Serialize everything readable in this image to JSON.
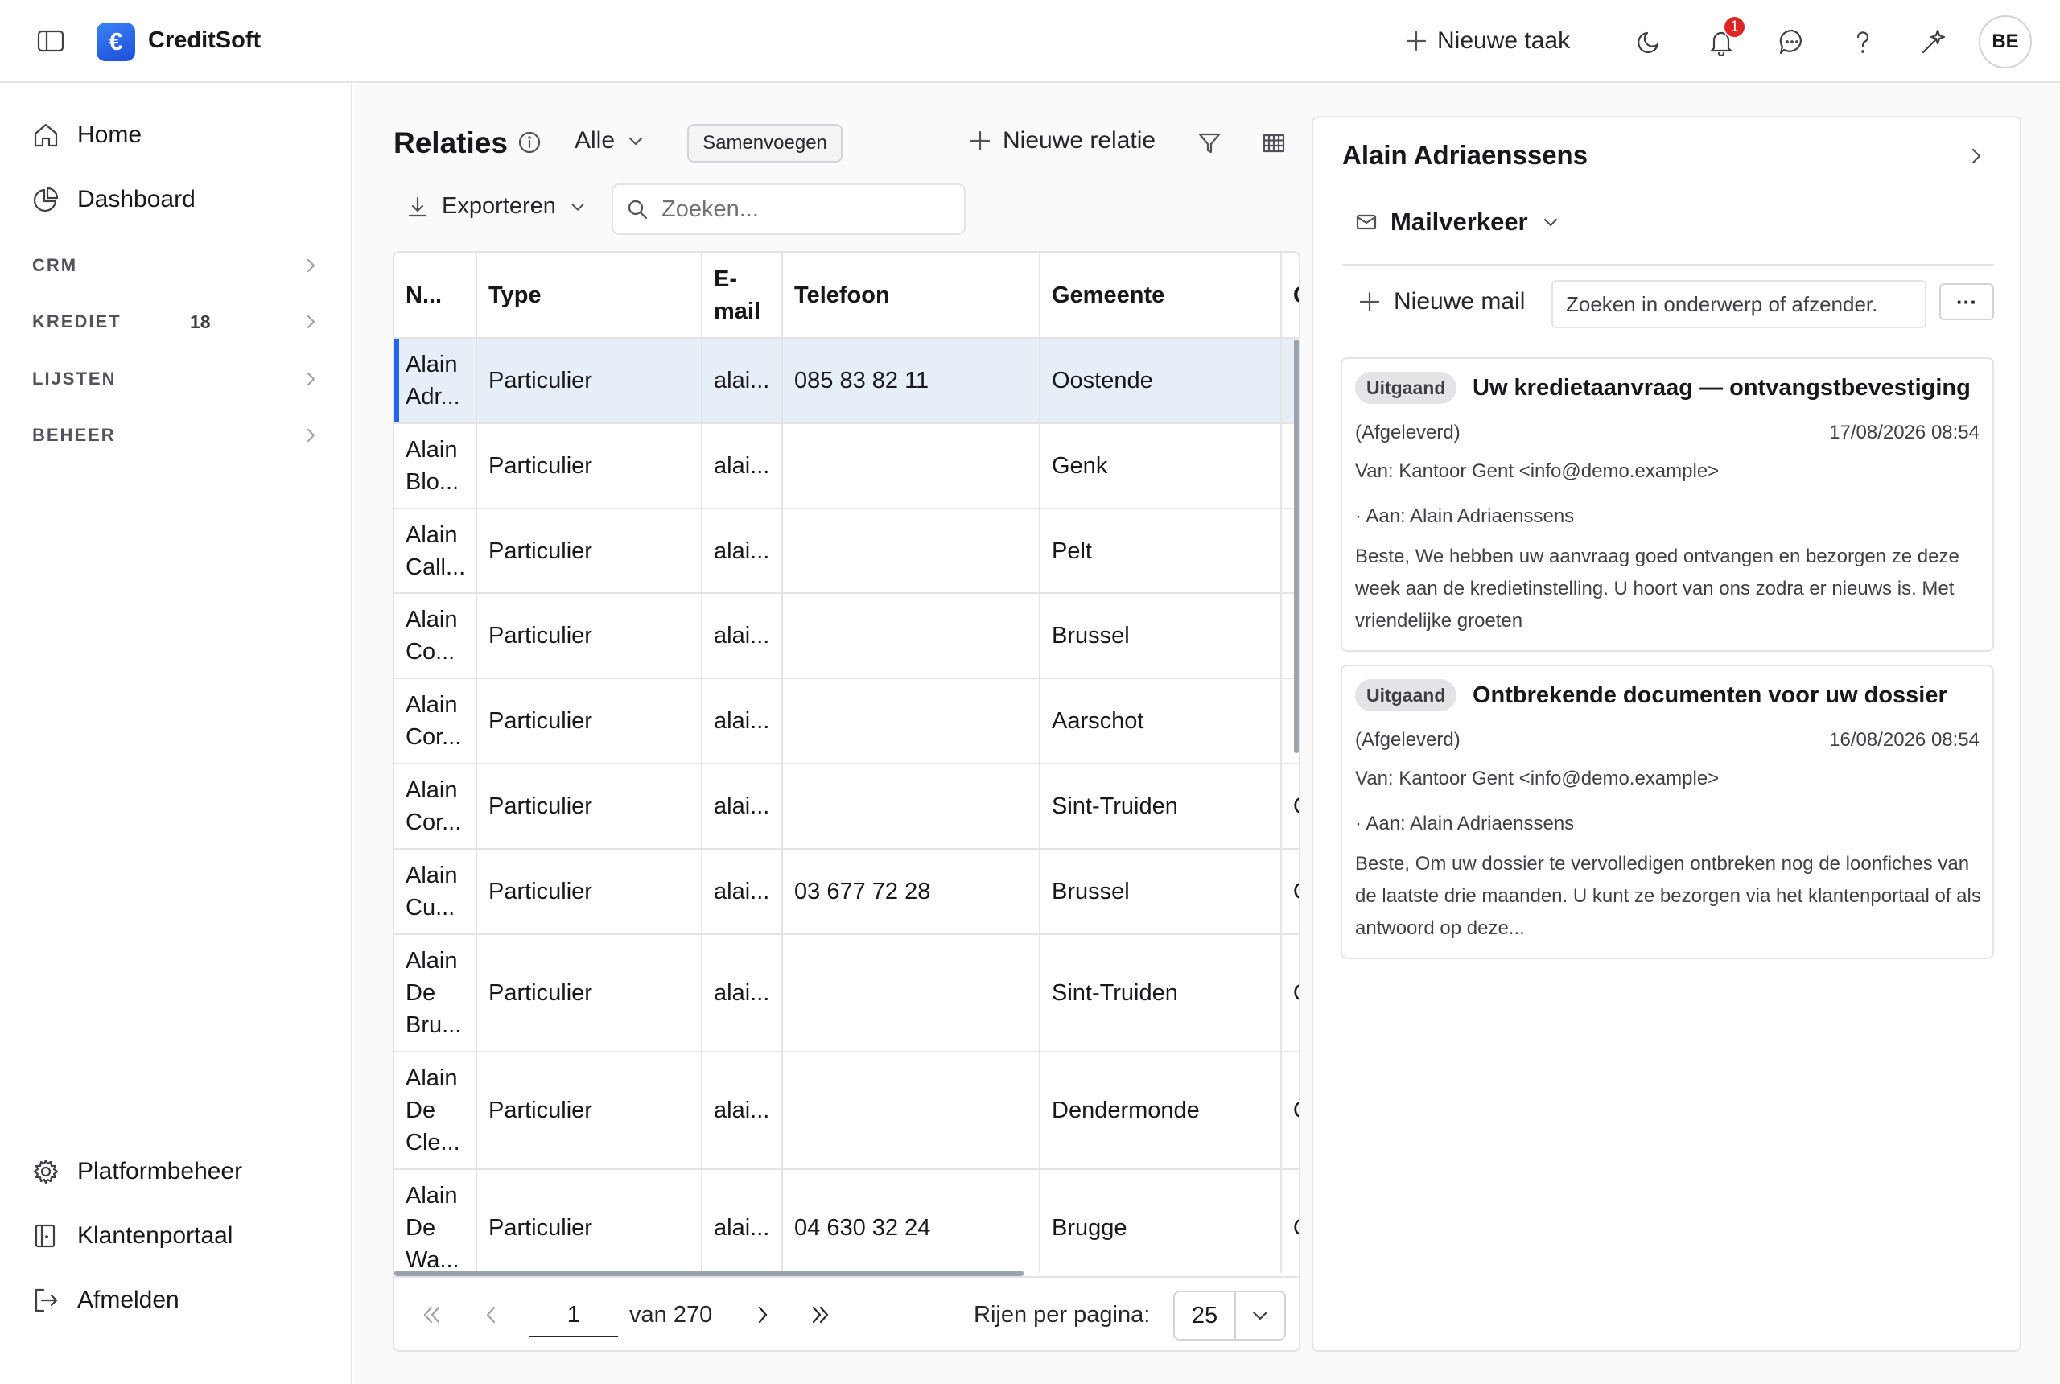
{
  "app": {
    "name": "CreditSoft",
    "logo_glyph": "€"
  },
  "topbar": {
    "new_task_label": "Nieuwe taak",
    "notification_count": "1",
    "avatar_initials": "BE"
  },
  "sidebar": {
    "top_items": [
      {
        "label": "Home",
        "icon": "home-icon"
      },
      {
        "label": "Dashboard",
        "icon": "pie-chart-icon"
      }
    ],
    "groups": [
      {
        "label": "CRM",
        "count": ""
      },
      {
        "label": "KREDIET",
        "count": "18"
      },
      {
        "label": "LIJSTEN",
        "count": ""
      },
      {
        "label": "BEHEER",
        "count": ""
      }
    ],
    "bottom_items": [
      {
        "label": "Platformbeheer",
        "icon": "gear-icon"
      },
      {
        "label": "Klantenportaal",
        "icon": "portal-icon"
      },
      {
        "label": "Afmelden",
        "icon": "logout-icon"
      }
    ]
  },
  "relations": {
    "title": "Relaties",
    "scope": "Alle",
    "merge_label": "Samenvoegen",
    "new_label": "Nieuwe relatie",
    "export_label": "Exporteren",
    "search_placeholder": "Zoeken...",
    "columns": [
      "N...",
      "Type",
      "E-mail",
      "Telefoon",
      "Gemeente",
      "G"
    ],
    "rows": [
      {
        "name": "Alain Adr...",
        "type": "Particulier",
        "email": "alai...",
        "phone": "085 83 82 11",
        "city": "Oostende",
        "extra": "O",
        "selected": true
      },
      {
        "name": "Alain Blo...",
        "type": "Particulier",
        "email": "alai...",
        "phone": "",
        "city": "Genk",
        "extra": "O"
      },
      {
        "name": "Alain Call...",
        "type": "Particulier",
        "email": "alai...",
        "phone": "",
        "city": "Pelt",
        "extra": "O"
      },
      {
        "name": "Alain Co...",
        "type": "Particulier",
        "email": "alai...",
        "phone": "",
        "city": "Brussel",
        "extra": "O"
      },
      {
        "name": "Alain Cor...",
        "type": "Particulier",
        "email": "alai...",
        "phone": "",
        "city": "Aarschot",
        "extra": "O"
      },
      {
        "name": "Alain Cor...",
        "type": "Particulier",
        "email": "alai...",
        "phone": "",
        "city": "Sint-Truiden",
        "extra": "O"
      },
      {
        "name": "Alain Cu...",
        "type": "Particulier",
        "email": "alai...",
        "phone": "03 677 72 28",
        "city": "Brussel",
        "extra": "O"
      },
      {
        "name": "Alain De Bru...",
        "type": "Particulier",
        "email": "alai...",
        "phone": "",
        "city": "Sint-Truiden",
        "extra": "O"
      },
      {
        "name": "Alain De Cle...",
        "type": "Particulier",
        "email": "alai...",
        "phone": "",
        "city": "Dendermonde",
        "extra": "O"
      },
      {
        "name": "Alain De Wa...",
        "type": "Particulier",
        "email": "alai...",
        "phone": "04 630 32 24",
        "city": "Brugge",
        "extra": "O"
      }
    ],
    "pagination": {
      "page": "1",
      "total_label": "van 270",
      "rows_label": "Rijen per pagina:",
      "rows_per_page": "25"
    }
  },
  "detail": {
    "name": "Alain Adriaenssens",
    "tab_label": "Mailverkeer",
    "new_mail_label": "Nieuwe mail",
    "search_placeholder": "Zoeken in onderwerp of afzender.",
    "more_label": "···",
    "mails": [
      {
        "badge": "Uitgaand",
        "subject": "Uw kredietaanvraag — ontvangstbevestiging",
        "status": "(Afgeleverd)",
        "date": "17/08/2026 08:54",
        "from": "Van: Kantoor Gent <info@demo.example>",
        "to": "· Aan: Alain Adriaenssens",
        "body": "Beste, We hebben uw aanvraag goed ontvangen en bezorgen ze deze week aan de kredietinstelling. U hoort van ons zodra er nieuws is. Met vriendelijke groeten"
      },
      {
        "badge": "Uitgaand",
        "subject": "Ontbrekende documenten voor uw dossier",
        "status": "(Afgeleverd)",
        "date": "16/08/2026 08:54",
        "from": "Van: Kantoor Gent <info@demo.example>",
        "to": "· Aan: Alain Adriaenssens",
        "body": "Beste, Om uw dossier te vervolledigen ontbreken nog de loonfiches van de laatste drie maanden. U kunt ze bezorgen via het klantenportaal of als antwoord op deze..."
      }
    ]
  },
  "colors": {
    "accent": "#2563eb",
    "selected_row": "#e6eef8",
    "badge_red": "#dc2626"
  }
}
